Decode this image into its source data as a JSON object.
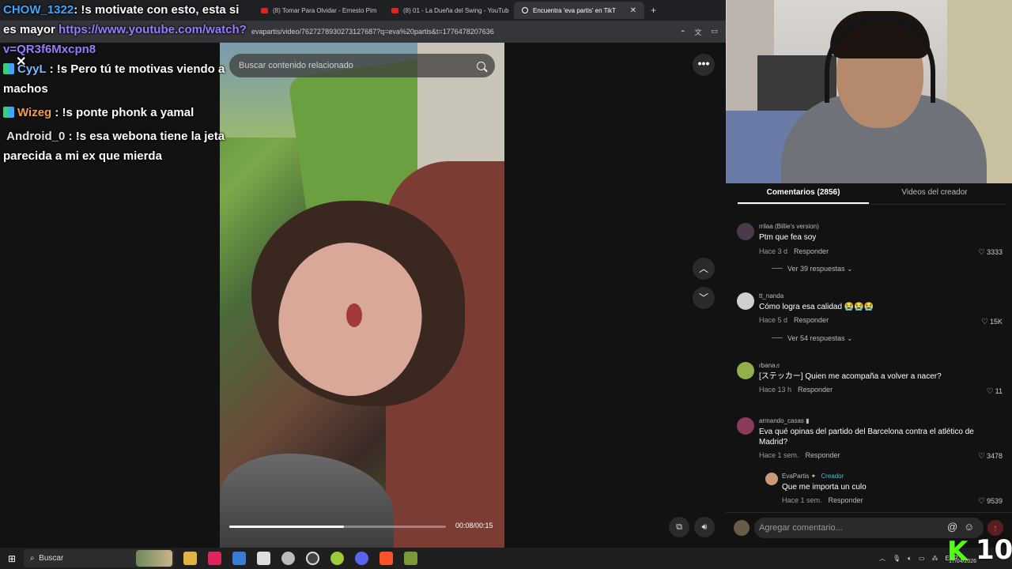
{
  "browser": {
    "tabs": [
      {
        "label": "(8) Tomar Para Olvidar - Ernesto Pim",
        "icon": "youtube-icon",
        "active": false
      },
      {
        "label": "(8) 01 - La Dueña del Swing - YouTub",
        "icon": "youtube-icon",
        "active": false
      },
      {
        "label": "Encuentra 'eva partis' en TikT",
        "icon": "tiktok-icon",
        "active": true
      }
    ],
    "new_tab": "+",
    "url": "evapartis/video/7627278930273127687?q=eva%20partis&t=1776478207636"
  },
  "chat": [
    {
      "user": "CHOW_1322",
      "text": ": !s motivate con esto, esta si es mayor ",
      "link": "https://www.youtube.com/watch?v=QR3f6Mxcpn8"
    },
    {
      "user": "CyyL",
      "text": ": !s Pero tú te motivas viendo a machos"
    },
    {
      "user": "Wizeg",
      "text": ": !s ponte phonk a yamal"
    },
    {
      "user": "Android_0",
      "text": ": !s esa webona tiene la jeta parecida a mi ex que mierda"
    }
  ],
  "player": {
    "search_placeholder": "Buscar contenido relacionado",
    "time": "00:08/00:15",
    "progress": 0.53
  },
  "panel": {
    "tabs": [
      "Comentarios (2856)",
      "Videos del creador"
    ],
    "reply_label": "Responder",
    "comments": [
      {
        "user": "rrilaa (Billie's version)",
        "text": "Ptm que fea soy",
        "time": "Hace 3 d",
        "likes": "3333",
        "replies": "Ver 39 respuestas"
      },
      {
        "user": "tt_nanda",
        "text": "Cómo logra esa calidad 😭😭😭",
        "time": "Hace 5 d",
        "likes": "15K",
        "replies": "Ver 54 respuestas"
      },
      {
        "user": "ɾbana♬",
        "text": "[ステッカー] Quien me acompaña a volver a nacer?",
        "time": "Hace 13 h",
        "likes": "11"
      },
      {
        "user": "armando_casas ▮",
        "text": "Eva qué opinas del partido del Barcelona contra el atlético de Madrid?",
        "time": "Hace 1 sem.",
        "likes": "3478"
      },
      {
        "user": "EvaPartis",
        "creator": "Creador",
        "text": "Que me importa un culo",
        "time": "Hace 1 sem.",
        "likes": "9539"
      }
    ],
    "compose_placeholder": "Agregar comentario..."
  },
  "taskbar": {
    "search": "Buscar",
    "lang": "ESP",
    "date": "17/04/2026",
    "kick_count": "10"
  }
}
